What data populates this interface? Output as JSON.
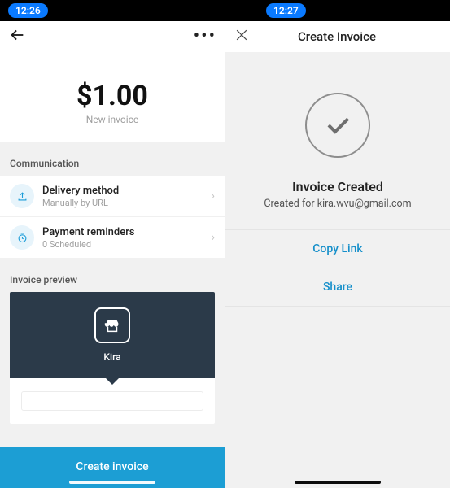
{
  "left": {
    "status_time": "12:26",
    "amount": "$1.00",
    "amount_sub": "New invoice",
    "section_comm": "Communication",
    "delivery": {
      "title": "Delivery method",
      "sub": "Manually by URL"
    },
    "reminders": {
      "title": "Payment reminders",
      "sub": "0 Scheduled"
    },
    "section_preview": "Invoice preview",
    "merchant_name": "Kira",
    "cta": "Create invoice"
  },
  "right": {
    "status_time": "12:27",
    "nav_title": "Create Invoice",
    "confirm_title": "Invoice Created",
    "confirm_sub": "Created for kira.wvu@gmail.com",
    "copy_link": "Copy Link",
    "share": "Share"
  },
  "colors": {
    "accent": "#1c9ed4",
    "link": "#158fca",
    "hero": "#2b3a49"
  }
}
